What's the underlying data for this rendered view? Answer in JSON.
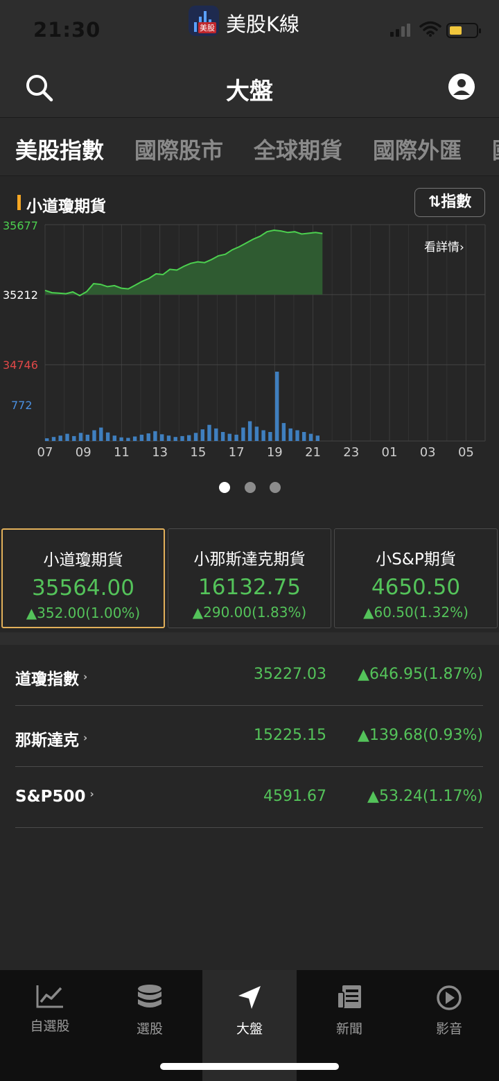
{
  "status_bar": {
    "time": "21:30",
    "app_name": "美股K線",
    "app_icon_tag": "美股"
  },
  "header": {
    "title": "大盤"
  },
  "tabs": [
    {
      "label": "美股指數",
      "active": true
    },
    {
      "label": "國際股市",
      "active": false
    },
    {
      "label": "全球期貨",
      "active": false
    },
    {
      "label": "國際外匯",
      "active": false
    },
    {
      "label": "國",
      "active": false
    }
  ],
  "chart_section": {
    "title": "小道瓊期貨",
    "index_toggle": "⇅指數",
    "details_link": "看詳情›",
    "pager": {
      "count": 3,
      "active": 0
    }
  },
  "chart_data": {
    "type": "line",
    "title": "小道瓊期貨",
    "price_axis_labels": [
      "35677",
      "35212",
      "34746"
    ],
    "volume_axis_label": "772",
    "x_tick_labels": [
      "07",
      "09",
      "11",
      "13",
      "15",
      "17",
      "19",
      "21",
      "23",
      "01",
      "03",
      "05"
    ],
    "ylim": [
      34746,
      35677
    ],
    "reference_price": 35212,
    "series": [
      {
        "values": [
          35240,
          35225,
          35222,
          35218,
          35230,
          35205,
          35232,
          35285,
          35280,
          35265,
          35272,
          35255,
          35250,
          35275,
          35300,
          35320,
          35350,
          35345,
          35380,
          35375,
          35400,
          35420,
          35430,
          35425,
          35445,
          35470,
          35480,
          35510,
          35530,
          35555,
          35580,
          35600,
          35630,
          35640,
          35635,
          35625,
          35630,
          35615,
          35620,
          35625,
          35618
        ]
      }
    ],
    "volume": [
      30,
      45,
      60,
      80,
      55,
      90,
      70,
      120,
      150,
      95,
      60,
      40,
      35,
      50,
      70,
      85,
      110,
      75,
      60,
      45,
      55,
      65,
      90,
      130,
      180,
      140,
      100,
      80,
      70,
      150,
      220,
      160,
      120,
      100,
      772,
      200,
      140,
      120,
      100,
      80,
      60
    ],
    "grid": true,
    "colors": {
      "line": "#4cd04f",
      "fill": "#2f5b31",
      "volume": "#3f7fbf",
      "low_label": "#e04848",
      "volume_label": "#4a90e2"
    }
  },
  "futures_cards": [
    {
      "name": "小道瓊期貨",
      "price": "35564.00",
      "change": "▲352.00(1.00%)",
      "selected": true
    },
    {
      "name": "小那斯達克期貨",
      "price": "16132.75",
      "change": "▲290.00(1.83%)",
      "selected": false
    },
    {
      "name": "小S&P期貨",
      "price": "4650.50",
      "change": "▲60.50(1.32%)",
      "selected": false
    }
  ],
  "indices": [
    {
      "name": "道瓊指數",
      "value": "35227.03",
      "change": "▲646.95(1.87%)"
    },
    {
      "name": "那斯達克",
      "value": "15225.15",
      "change": "▲139.68(0.93%)"
    },
    {
      "name": "S&P500",
      "value": "4591.67",
      "change": "▲53.24(1.17%)"
    }
  ],
  "bottom_nav": [
    {
      "label": "自選股",
      "icon": "line-chart-icon",
      "active": false
    },
    {
      "label": "選股",
      "icon": "database-icon",
      "active": false
    },
    {
      "label": "大盤",
      "icon": "navigation-arrow-icon",
      "active": true
    },
    {
      "label": "新聞",
      "icon": "newspaper-icon",
      "active": false
    },
    {
      "label": "影音",
      "icon": "play-circle-icon",
      "active": false
    }
  ]
}
